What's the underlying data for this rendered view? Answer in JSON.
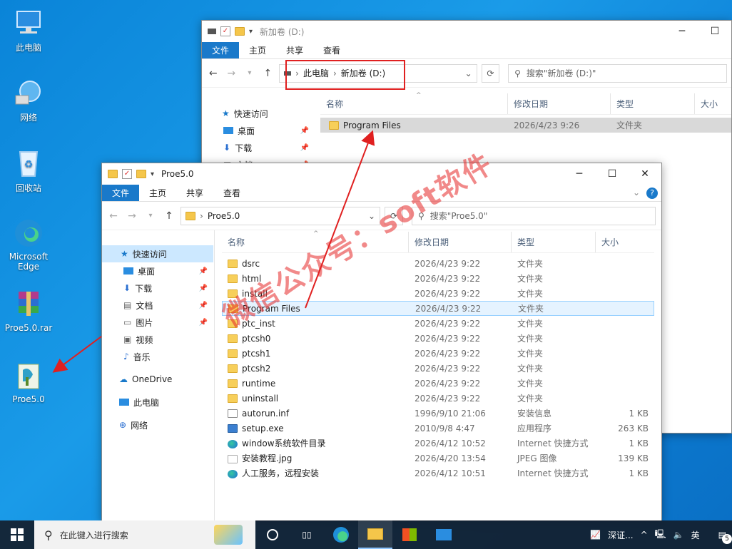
{
  "desktop": {
    "icons": [
      {
        "label": "此电脑",
        "icon": "this-pc-icon"
      },
      {
        "label": "网络",
        "icon": "network-icon"
      },
      {
        "label": "回收站",
        "icon": "recycle-bin-icon"
      },
      {
        "label": "Microsoft Edge",
        "icon": "edge-icon"
      },
      {
        "label": "Proe5.0.rar",
        "icon": "winrar-archive-icon"
      },
      {
        "label": "Proe5.0",
        "icon": "folder-shortcut-icon"
      }
    ]
  },
  "back_window": {
    "title": "新加卷 (D:)",
    "ribbon": {
      "file": "文件",
      "tabs": [
        "主页",
        "共享",
        "查看"
      ]
    },
    "address": {
      "items": [
        "此电脑",
        "新加卷 (D:)"
      ]
    },
    "search_placeholder": "搜索\"新加卷 (D:)\"",
    "nav": [
      {
        "label": "快速访问",
        "pinned": false
      },
      {
        "label": "桌面",
        "pinned": true
      },
      {
        "label": "下载",
        "pinned": true
      },
      {
        "label": "文档",
        "pinned": true
      }
    ],
    "columns": [
      "名称",
      "修改日期",
      "类型",
      "大小"
    ],
    "rows": [
      {
        "name": "Program Files",
        "date": "2026/4/23 9:26",
        "type": "文件夹",
        "size": ""
      }
    ]
  },
  "front_window": {
    "title": "Proe5.0",
    "ribbon": {
      "file": "文件",
      "tabs": [
        "主页",
        "共享",
        "查看"
      ]
    },
    "address": {
      "items": [
        "Proe5.0"
      ]
    },
    "search_placeholder": "搜索\"Proe5.0\"",
    "nav": [
      {
        "label": "快速访问",
        "pinned": false,
        "selected": true
      },
      {
        "label": "桌面",
        "pinned": true
      },
      {
        "label": "下载",
        "pinned": true
      },
      {
        "label": "文档",
        "pinned": true
      },
      {
        "label": "图片",
        "pinned": true
      },
      {
        "label": "视频",
        "pinned": false
      },
      {
        "label": "音乐",
        "pinned": false
      },
      {
        "label": "OneDrive",
        "pinned": false
      },
      {
        "label": "此电脑",
        "pinned": false
      },
      {
        "label": "网络",
        "pinned": false
      }
    ],
    "columns": [
      "名称",
      "修改日期",
      "类型",
      "大小"
    ],
    "rows": [
      {
        "name": "dsrc",
        "date": "2026/4/23 9:22",
        "type": "文件夹",
        "size": "",
        "kind": "folder"
      },
      {
        "name": "html",
        "date": "2026/4/23 9:22",
        "type": "文件夹",
        "size": "",
        "kind": "folder"
      },
      {
        "name": "install",
        "date": "2026/4/23 9:22",
        "type": "文件夹",
        "size": "",
        "kind": "folder"
      },
      {
        "name": "Program Files",
        "date": "2026/4/23 9:22",
        "type": "文件夹",
        "size": "",
        "kind": "folder",
        "highlight": true
      },
      {
        "name": "ptc_inst",
        "date": "2026/4/23 9:22",
        "type": "文件夹",
        "size": "",
        "kind": "folder"
      },
      {
        "name": "ptcsh0",
        "date": "2026/4/23 9:22",
        "type": "文件夹",
        "size": "",
        "kind": "folder"
      },
      {
        "name": "ptcsh1",
        "date": "2026/4/23 9:22",
        "type": "文件夹",
        "size": "",
        "kind": "folder"
      },
      {
        "name": "ptcsh2",
        "date": "2026/4/23 9:22",
        "type": "文件夹",
        "size": "",
        "kind": "folder"
      },
      {
        "name": "runtime",
        "date": "2026/4/23 9:22",
        "type": "文件夹",
        "size": "",
        "kind": "folder"
      },
      {
        "name": "uninstall",
        "date": "2026/4/23 9:22",
        "type": "文件夹",
        "size": "",
        "kind": "folder"
      },
      {
        "name": "autorun.inf",
        "date": "1996/9/10 21:06",
        "type": "安装信息",
        "size": "1 KB",
        "kind": "inf"
      },
      {
        "name": "setup.exe",
        "date": "2010/9/8 4:47",
        "type": "应用程序",
        "size": "263 KB",
        "kind": "exe"
      },
      {
        "name": "window系统软件目录",
        "date": "2026/4/12 10:52",
        "type": "Internet 快捷方式",
        "size": "1 KB",
        "kind": "url"
      },
      {
        "name": "安装教程.jpg",
        "date": "2026/4/20 13:54",
        "type": "JPEG 图像",
        "size": "139 KB",
        "kind": "jpg"
      },
      {
        "name": "人工服务，远程安装",
        "date": "2026/4/12 10:51",
        "type": "Internet 快捷方式",
        "size": "1 KB",
        "kind": "url"
      }
    ]
  },
  "watermark": "微信公众号：soft软件",
  "taskbar": {
    "search_placeholder": "在此键入进行搜索",
    "tray_text": "深证...",
    "ime": "英",
    "notifications": "5"
  },
  "colors": {
    "accent": "#1979ca",
    "annotation": "#e02020"
  }
}
